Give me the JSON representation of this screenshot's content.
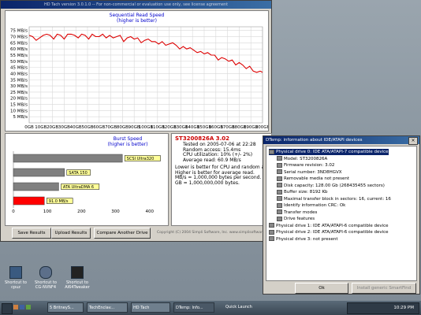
{
  "hdtach": {
    "title": "HD Tach version 3.0.1.0  -- For non-commercial or evaluation use only, see license agreement",
    "graph_title": "Sequential Read Speed",
    "graph_subtitle": "(higher is better)",
    "burst_title": "Burst Speed",
    "burst_subtitle": "(higher is better)",
    "drive_name": "ST3200826A 3.02",
    "info_lines": [
      "Tested on 2005-07-06 at 22:28",
      "Random access: 15.4ms",
      "CPU utilization: 10% (+/- 2%)",
      "Average read: 60.9 MB/s"
    ],
    "notes": [
      "Lower is better for CPU and random access.",
      "Higher is better for average read.",
      "MB/s = 1,000,000 bytes per second.",
      "GB = 1,000,000,000 bytes."
    ],
    "buttons": {
      "save": "Save Results",
      "upload": "Upload Results",
      "compare": "Compare Another Drive"
    },
    "copyright": "Copyright (C) 2004 Simpli Software, Inc. www.simplisoftware.com"
  },
  "chart_data": [
    {
      "type": "line",
      "title": "Sequential Read Speed",
      "subtitle": "(higher is better)",
      "ylabel_unit": "MB/s",
      "y_ticks": [
        "75 MB/s",
        "70 MB/s",
        "65 MB/s",
        "60 MB/s",
        "55 MB/s",
        "50 MB/s",
        "45 MB/s",
        "40 MB/s",
        "35 MB/s",
        "30 MB/s",
        "25 MB/s",
        "20 MB/s",
        "15 MB/s",
        "10 MB/s",
        "5 MB/s"
      ],
      "x_ticks": [
        "0GB",
        "10GB",
        "20GB",
        "30GB",
        "40GB",
        "50GB",
        "60GB",
        "70GB",
        "80GB",
        "90GB",
        "100GB",
        "110GB",
        "120GB",
        "130GB",
        "140GB",
        "150GB",
        "160GB",
        "170GB",
        "180GB",
        "190GB",
        "200GB"
      ],
      "ylim": [
        0,
        78
      ],
      "xlim": [
        0,
        200
      ],
      "grid": true,
      "color": "#dd0000",
      "x": [
        0,
        3,
        6,
        9,
        12,
        15,
        18,
        21,
        24,
        27,
        30,
        33,
        36,
        39,
        42,
        45,
        48,
        51,
        54,
        57,
        60,
        63,
        66,
        69,
        72,
        75,
        78,
        81,
        84,
        87,
        90,
        93,
        96,
        99,
        102,
        105,
        108,
        111,
        114,
        117,
        120,
        123,
        126,
        129,
        132,
        135,
        138,
        141,
        144,
        147,
        150,
        153,
        156,
        159,
        162,
        165,
        168,
        171,
        174,
        177,
        180,
        183,
        186,
        189,
        192,
        195,
        198,
        200
      ],
      "values": [
        71,
        70,
        67,
        69,
        71,
        72,
        71,
        68,
        72,
        71,
        68,
        72,
        72,
        71,
        69,
        72,
        71,
        68,
        72,
        70,
        70,
        72,
        69,
        71,
        69,
        70,
        71,
        66,
        69,
        70,
        68,
        69,
        65,
        67,
        68,
        66,
        66,
        64,
        66,
        63,
        64,
        65,
        63,
        60,
        62,
        60,
        61,
        59,
        57,
        58,
        56,
        57,
        55,
        55,
        51,
        53,
        52,
        50,
        51,
        47,
        49,
        47,
        44,
        46,
        42,
        41,
        42,
        41
      ]
    },
    {
      "type": "bar",
      "title": "Burst Speed",
      "subtitle": "(higher is better)",
      "orientation": "horizontal",
      "categories": [
        "SCSI Ultra320",
        "SATA 150",
        "ATA UltraDMA 6",
        "91.0 MB/s"
      ],
      "values": [
        320,
        150,
        133,
        91
      ],
      "colors": [
        "#808080",
        "#808080",
        "#808080",
        "#ff0000"
      ],
      "x_ticks": [
        "0",
        "100",
        "200",
        "300",
        "400"
      ],
      "xlim": [
        0,
        440
      ]
    }
  ],
  "dtemp": {
    "title": "DTemp: information about IDE/ATAPI devices",
    "tree": [
      {
        "level": 0,
        "text": "Physical drive 0: IDE ATA/ATAPI-7 compatible device",
        "selected": true
      },
      {
        "level": 1,
        "text": "Model: ST3200826A"
      },
      {
        "level": 1,
        "text": "Firmware revision: 3.02"
      },
      {
        "level": 1,
        "text": "Serial number: 3ND8HGVX"
      },
      {
        "level": 1,
        "text": "Removable media not present"
      },
      {
        "level": 1,
        "text": "Disk capacity: 128.00 Gb  (268435455 sectors)"
      },
      {
        "level": 1,
        "text": "Buffer size: 8192 Kb"
      },
      {
        "level": 1,
        "text": "Maximal transfer block in sectors: 16, current: 16"
      },
      {
        "level": 1,
        "text": "Identify information CRC: Ok"
      },
      {
        "level": 1,
        "text": "Transfer modes"
      },
      {
        "level": 1,
        "text": "Drive features"
      },
      {
        "level": 0,
        "text": "Physical drive 1: IDE ATA/ATAPI-6 compatible device"
      },
      {
        "level": 0,
        "text": "Physical drive 2: IDE ATA/ATAPI-6 compatible device"
      },
      {
        "level": 0,
        "text": "Physical drive 3: not present"
      }
    ],
    "ok_label": "Ok",
    "install_label": "Install generic SmartFind"
  },
  "desktop_icons": [
    {
      "label": "Shortcut to cpuz"
    },
    {
      "label": "Shortcut to CG-NVNF4"
    },
    {
      "label": "Shortcut to AI64Tweaker"
    }
  ],
  "taskbar": {
    "tasks": [
      "5 BritneyS...",
      "TechEnclav...",
      "HD Tach",
      "DTemp: Info...",
      "Quick Launch"
    ],
    "clock": "10:29 PM"
  }
}
